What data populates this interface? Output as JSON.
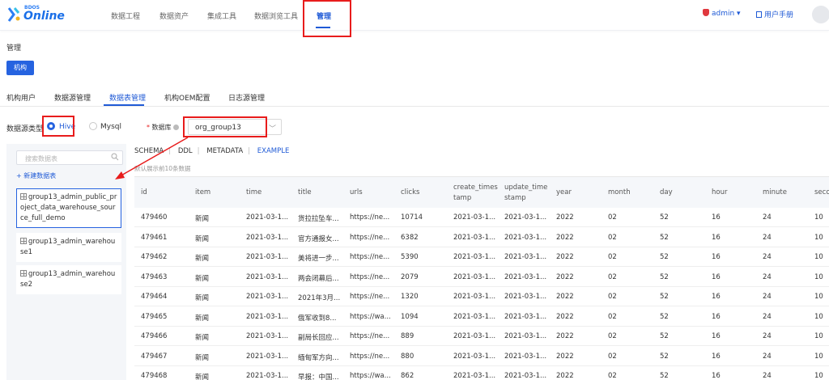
{
  "brand": {
    "small": "BDOS",
    "big": "Online"
  },
  "nav": {
    "items": [
      "数据工程",
      "数据资产",
      "集成工具",
      "数据浏览工具",
      "管理"
    ]
  },
  "user": {
    "name": "admin ▾",
    "manual": "用户手册"
  },
  "crumb": "管理",
  "org_button": "机构",
  "tabs": [
    "机构用户",
    "数据源管理",
    "数据表管理",
    "机构OEM配置",
    "日志源管理"
  ],
  "filter": {
    "source_label": "数据源类型",
    "hive": "Hive",
    "mysql": "Mysql",
    "db_label": "数据库",
    "db_value": "org_group13",
    "chevron": "﹀"
  },
  "sidebar": {
    "search_placeholder": "搜索数据表",
    "new_table": "+ 新建数据表",
    "tables": [
      "group13_admin_public_project_data_warehouse_source_full_demo",
      "group13_admin_warehouse1",
      "group13_admin_warehouse2"
    ]
  },
  "subtabs": {
    "schema": "SCHEMA",
    "ddl": "DDL",
    "metadata": "METADATA",
    "example": "EXAMPLE",
    "sep": "|"
  },
  "hint": "默认展示前10条数据",
  "table": {
    "headers": [
      "id",
      "item",
      "time",
      "title",
      "urls",
      "clicks",
      "create_times\ntamp",
      "update_time\nstamp",
      "year",
      "month",
      "day",
      "hour",
      "minute",
      "seco"
    ],
    "rows": [
      [
        "479460",
        "新闻",
        "2021-03-1...",
        "货拉拉坠车...",
        "https://ne...",
        "10714",
        "2021-03-1...",
        "2021-03-1...",
        "2022",
        "02",
        "52",
        "16",
        "24",
        "10"
      ],
      [
        "479461",
        "新闻",
        "2021-03-1...",
        "官方通报女...",
        "https://ne...",
        "6382",
        "2021-03-1...",
        "2021-03-1...",
        "2022",
        "02",
        "52",
        "16",
        "24",
        "10"
      ],
      [
        "479462",
        "新闻",
        "2021-03-1...",
        "美将进一步...",
        "https://ne...",
        "5390",
        "2021-03-1...",
        "2021-03-1...",
        "2022",
        "02",
        "52",
        "16",
        "24",
        "10"
      ],
      [
        "479463",
        "新闻",
        "2021-03-1...",
        "两会闭幕后...",
        "https://ne...",
        "2079",
        "2021-03-1...",
        "2021-03-1...",
        "2022",
        "02",
        "52",
        "16",
        "24",
        "10"
      ],
      [
        "479464",
        "新闻",
        "2021-03-1...",
        "2021年3月...",
        "https://ne...",
        "1320",
        "2021-03-1...",
        "2021-03-1...",
        "2022",
        "02",
        "52",
        "16",
        "24",
        "10"
      ],
      [
        "479465",
        "新闻",
        "2021-03-1...",
        "俄军收到8...",
        "https://wa...",
        "1094",
        "2021-03-1...",
        "2021-03-1...",
        "2022",
        "02",
        "52",
        "16",
        "24",
        "10"
      ],
      [
        "479466",
        "新闻",
        "2021-03-1...",
        "副局长回应...",
        "https://ne...",
        "889",
        "2021-03-1...",
        "2021-03-1...",
        "2022",
        "02",
        "52",
        "16",
        "24",
        "10"
      ],
      [
        "479467",
        "新闻",
        "2021-03-1...",
        "缅甸军方向...",
        "https://ne...",
        "880",
        "2021-03-1...",
        "2021-03-1...",
        "2022",
        "02",
        "52",
        "16",
        "24",
        "10"
      ],
      [
        "479468",
        "新闻",
        "2021-03-1...",
        "早报：中国...",
        "https://wa...",
        "862",
        "2021-03-1...",
        "2021-03-1...",
        "2022",
        "02",
        "52",
        "16",
        "24",
        "10"
      ]
    ]
  }
}
